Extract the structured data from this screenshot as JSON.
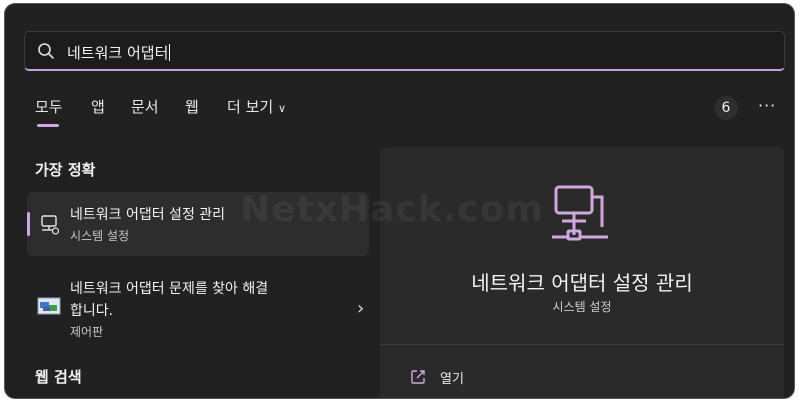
{
  "search": {
    "query": "네트워크 어댑터"
  },
  "tabs": [
    "모두",
    "앱",
    "문서",
    "웹",
    "더 보기"
  ],
  "badge_count": "6",
  "more_label": "···",
  "best_match": {
    "section": "가장 정확",
    "item": {
      "title": "네트워크 어댑터 설정 관리",
      "subtitle": "시스템 설정"
    }
  },
  "second_result": {
    "title_line1": "네트워크 어댑터 문제를 찾아 해결",
    "title_line2": "합니다.",
    "subtitle": "제어판"
  },
  "web_section": "웹 검색",
  "preview": {
    "title": "네트워크 어댑터 설정 관리",
    "subtitle": "시스템 설정",
    "action_open": "열기"
  },
  "watermark": "NetxHack.com",
  "colors": {
    "accent": "#d0a8e0",
    "background": "#212121",
    "preview_bg": "#2a2a2a"
  }
}
